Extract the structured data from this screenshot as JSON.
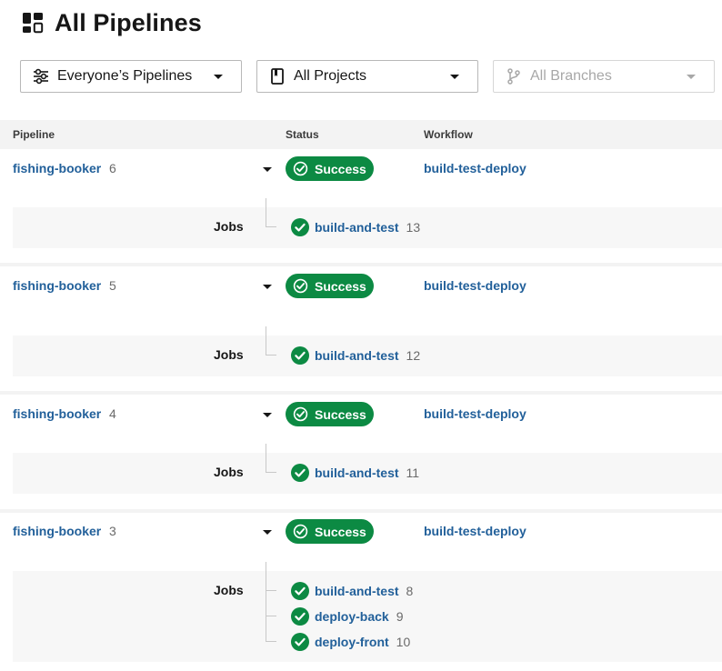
{
  "page": {
    "title": "All Pipelines",
    "icon": "dashboard-icon"
  },
  "filters": {
    "pipelines": {
      "label": "Everyone’s Pipelines",
      "icon": "filter-sliders-icon"
    },
    "projects": {
      "label": "All Projects",
      "icon": "project-bookmark-icon"
    },
    "branches": {
      "label": "All Branches",
      "icon": "branch-icon",
      "disabled": true
    }
  },
  "table": {
    "headers": {
      "pipeline": "Pipeline",
      "status": "Status",
      "workflow": "Workflow"
    }
  },
  "jobs_label": "Jobs",
  "pipelines": [
    {
      "name": "fishing-booker",
      "number": "6",
      "status": "Success",
      "workflow": "build-test-deploy",
      "jobs": [
        {
          "name": "build-and-test",
          "number": "13"
        }
      ]
    },
    {
      "name": "fishing-booker",
      "number": "5",
      "status": "Success",
      "workflow": "build-test-deploy",
      "jobs": [
        {
          "name": "build-and-test",
          "number": "12"
        }
      ]
    },
    {
      "name": "fishing-booker",
      "number": "4",
      "status": "Success",
      "workflow": "build-test-deploy",
      "jobs": [
        {
          "name": "build-and-test",
          "number": "11"
        }
      ]
    },
    {
      "name": "fishing-booker",
      "number": "3",
      "status": "Success",
      "workflow": "build-test-deploy",
      "jobs": [
        {
          "name": "build-and-test",
          "number": "8"
        },
        {
          "name": "deploy-back",
          "number": "9"
        },
        {
          "name": "deploy-front",
          "number": "10"
        }
      ]
    }
  ],
  "colors": {
    "success": "#0c8a43",
    "link": "#22609a",
    "header_bg": "#f3f3f3"
  }
}
